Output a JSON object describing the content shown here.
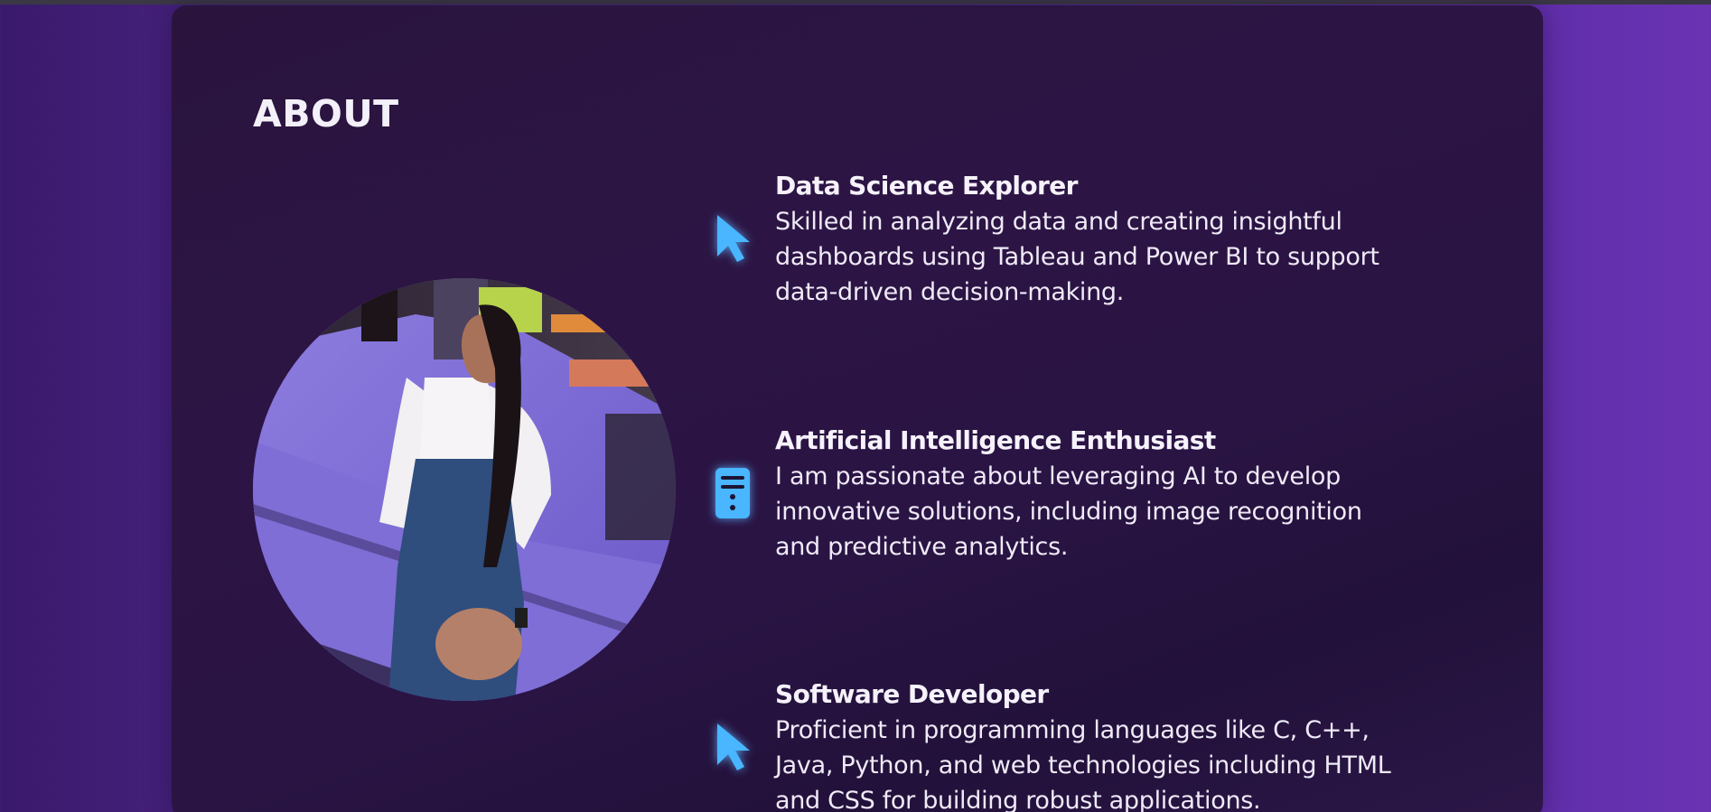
{
  "about": {
    "title": "ABOUT",
    "items": [
      {
        "title": "Data Science Explorer",
        "description": "Skilled in analyzing data and creating insightful dashboards using Tableau and Power BI to support data-driven decision-making.",
        "icon": "cursor-arrow-icon"
      },
      {
        "title": "Artificial Intelligence Enthusiast",
        "description": "I am passionate about leveraging AI to develop innovative solutions, including image recognition and predictive analytics.",
        "icon": "server-icon"
      },
      {
        "title": "Software Developer",
        "description": "Proficient in programming languages like C, C++, Java, Python, and web technologies including HTML and CSS for building robust applications.",
        "icon": "cursor-arrow-icon"
      }
    ]
  },
  "colors": {
    "background": "#4a2486",
    "card": "#2a1444",
    "accent_icon": "#49b6ff",
    "text": "#f4f0fa"
  }
}
